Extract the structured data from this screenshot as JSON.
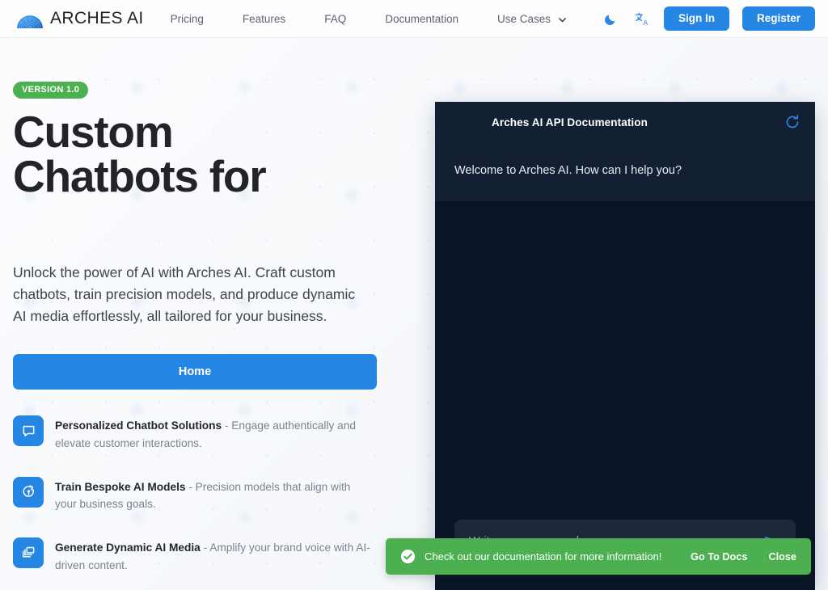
{
  "brand": {
    "name": "ARCHES AI",
    "logo_icon": "arch-dome-logo"
  },
  "nav": {
    "links": [
      {
        "label": "Pricing"
      },
      {
        "label": "Features"
      },
      {
        "label": "FAQ"
      },
      {
        "label": "Documentation"
      },
      {
        "label": "Use Cases",
        "has_dropdown": true
      }
    ],
    "dark_mode_icon": "moon-icon",
    "language_icon": "translate-icon",
    "sign_in_label": "Sign In",
    "register_label": "Register"
  },
  "hero": {
    "badge": "VERSION 1.0",
    "headline": "Custom Chatbots for",
    "subtext": "Unlock the power of AI with Arches AI. Craft custom chatbots, train precision models, and produce dynamic AI media effortlessly, all tailored for your business.",
    "cta_label": "Home",
    "features": [
      {
        "icon": "chat-bubble-icon",
        "title": "Personalized Chatbot Solutions",
        "description": " - Engage authentically and elevate customer interactions."
      },
      {
        "icon": "model-training-icon",
        "title": "Train Bespoke AI Models",
        "description": " - Precision models that align with your business goals."
      },
      {
        "icon": "media-layers-icon",
        "title": "Generate Dynamic AI Media",
        "description": " - Amplify your brand voice with AI-driven content."
      }
    ]
  },
  "chat_widget": {
    "title": "Arches AI API Documentation",
    "refresh_icon": "refresh-icon",
    "welcome_message": "Welcome to Arches AI. How can I help you?",
    "input_placeholder": "Write your message here...",
    "input_value": "",
    "send_icon": "send-icon"
  },
  "toast": {
    "status_icon": "check-circle-icon",
    "message": "Check out our documentation for more information!",
    "primary_action": "Go To Docs",
    "secondary_action": "Close"
  },
  "colors": {
    "accent_blue": "#2586e4",
    "success_green": "#4caf50",
    "chat_bg": "#0a1426",
    "chat_header_bg": "#131f33"
  }
}
